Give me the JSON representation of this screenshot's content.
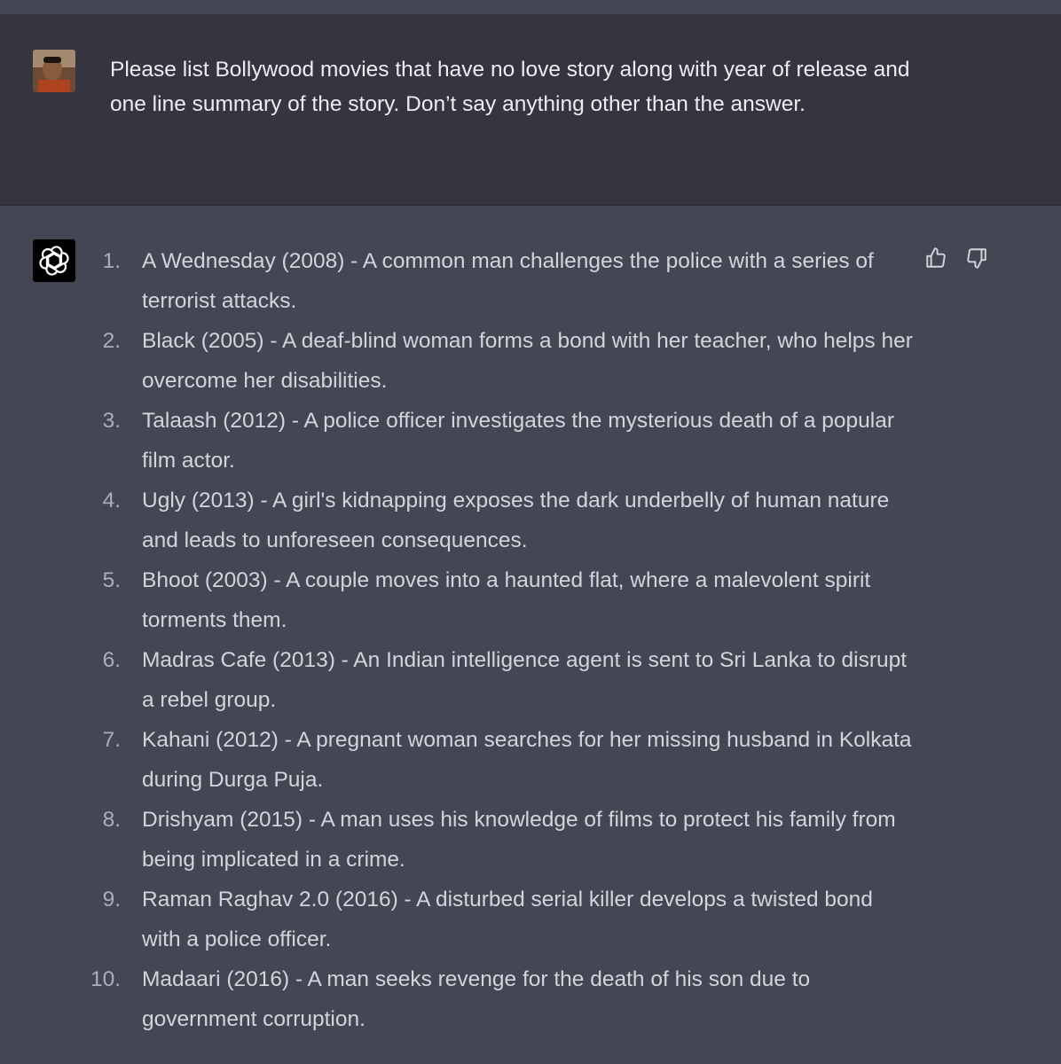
{
  "user_message": {
    "text": "Please list Bollywood movies that have no love story along with year of release and one line summary of the story. Don’t say anything other than the answer."
  },
  "assistant_message": {
    "items": [
      {
        "number": "1.",
        "text": "A Wednesday (2008) - A common man challenges the police with a series of terrorist attacks."
      },
      {
        "number": "2.",
        "text": "Black (2005) - A deaf-blind woman forms a bond with her teacher, who helps her overcome her disabilities."
      },
      {
        "number": "3.",
        "text": "Talaash (2012) - A police officer investigates the mysterious death of a popular film actor."
      },
      {
        "number": "4.",
        "text": "Ugly (2013) - A girl's kidnapping exposes the dark underbelly of human nature and leads to unforeseen consequences."
      },
      {
        "number": "5.",
        "text": "Bhoot (2003) - A couple moves into a haunted flat, where a malevolent spirit torments them."
      },
      {
        "number": "6.",
        "text": "Madras Cafe (2013) - An Indian intelligence agent is sent to Sri Lanka to disrupt a rebel group."
      },
      {
        "number": "7.",
        "text": "Kahani (2012) - A pregnant woman searches for her missing husband in Kolkata during Durga Puja."
      },
      {
        "number": "8.",
        "text": "Drishyam (2015) - A man uses his knowledge of films to protect his family from being implicated in a crime."
      },
      {
        "number": "9.",
        "text": "Raman Raghav 2.0 (2016) - A disturbed serial killer develops a twisted bond with a police officer."
      },
      {
        "number": "10.",
        "text": "Madaari (2016) - A man seeks revenge for the death of his son due to government corruption."
      }
    ]
  },
  "icons": {
    "user_avatar": "user-avatar",
    "assistant_avatar": "openai-logo-icon",
    "thumbs_up": "thumbs-up-icon",
    "thumbs_down": "thumbs-down-icon"
  },
  "colors": {
    "user_bg": "#343541",
    "assistant_bg": "#444654",
    "text": "#d1d5db",
    "number_text": "#acacbe"
  }
}
